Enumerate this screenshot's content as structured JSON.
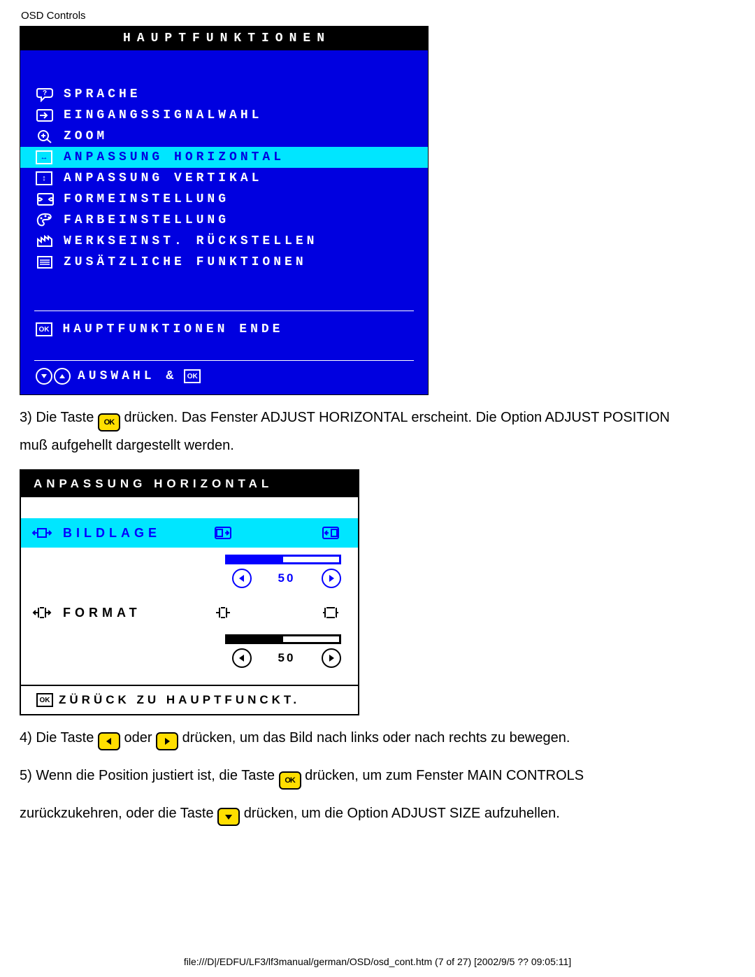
{
  "header": {
    "title": "OSD Controls"
  },
  "osd": {
    "title": "HAUPTFUNKTIONEN",
    "items": [
      {
        "icon": "speech-icon",
        "label": "SPRACHE"
      },
      {
        "icon": "input-icon",
        "label": "EINGANGSSIGNALWAHL"
      },
      {
        "icon": "zoom-icon",
        "label": "ZOOM"
      },
      {
        "icon": "horiz-icon",
        "label": "ANPASSUNG HORIZONTAL",
        "selected": true
      },
      {
        "icon": "vert-icon",
        "label": "ANPASSUNG VERTIKAL"
      },
      {
        "icon": "shape-icon",
        "label": "FORMEINSTELLUNG"
      },
      {
        "icon": "color-icon",
        "label": "FARBEINSTELLUNG"
      },
      {
        "icon": "factory-icon",
        "label": "WERKSEINST. RÜCKSTELLEN"
      },
      {
        "icon": "extra-icon",
        "label": "ZUSÄTZLICHE FUNKTIONEN"
      }
    ],
    "end_label": "HAUPTFUNKTIONEN ENDE",
    "bottom_label": "AUSWAHL &"
  },
  "step3": {
    "pre": "3) Die Taste ",
    "post": " drücken. Das Fenster ADJUST HORIZONTAL erscheint. Die Option ADJUST POSITION muß aufgehellt dargestellt werden."
  },
  "adj": {
    "title": "ANPASSUNG HORIZONTAL",
    "position": {
      "label": "BILDLAGE",
      "value": "50",
      "fill_pct": 50
    },
    "size": {
      "label": "FORMAT",
      "value": "50",
      "fill_pct": 50
    },
    "footer": "ZÜRÜCK ZU HAUPTFUNCKT."
  },
  "step4": {
    "pre": "4) Die Taste ",
    "mid": " oder ",
    "post": " drücken, um das Bild nach links oder nach rechts zu bewegen."
  },
  "step5": {
    "line1_pre": "5) Wenn die Position justiert ist, die Taste ",
    "line1_post": " drücken, um zum Fenster MAIN CONTROLS",
    "line2_pre": "zurückzukehren, oder die Taste ",
    "line2_post": " drücken, um die Option ADJUST SIZE aufzuhellen."
  },
  "footer_path": "file:///D|/EDFU/LF3/lf3manual/german/OSD/osd_cont.htm (7 of 27) [2002/9/5 ?? 09:05:11]"
}
